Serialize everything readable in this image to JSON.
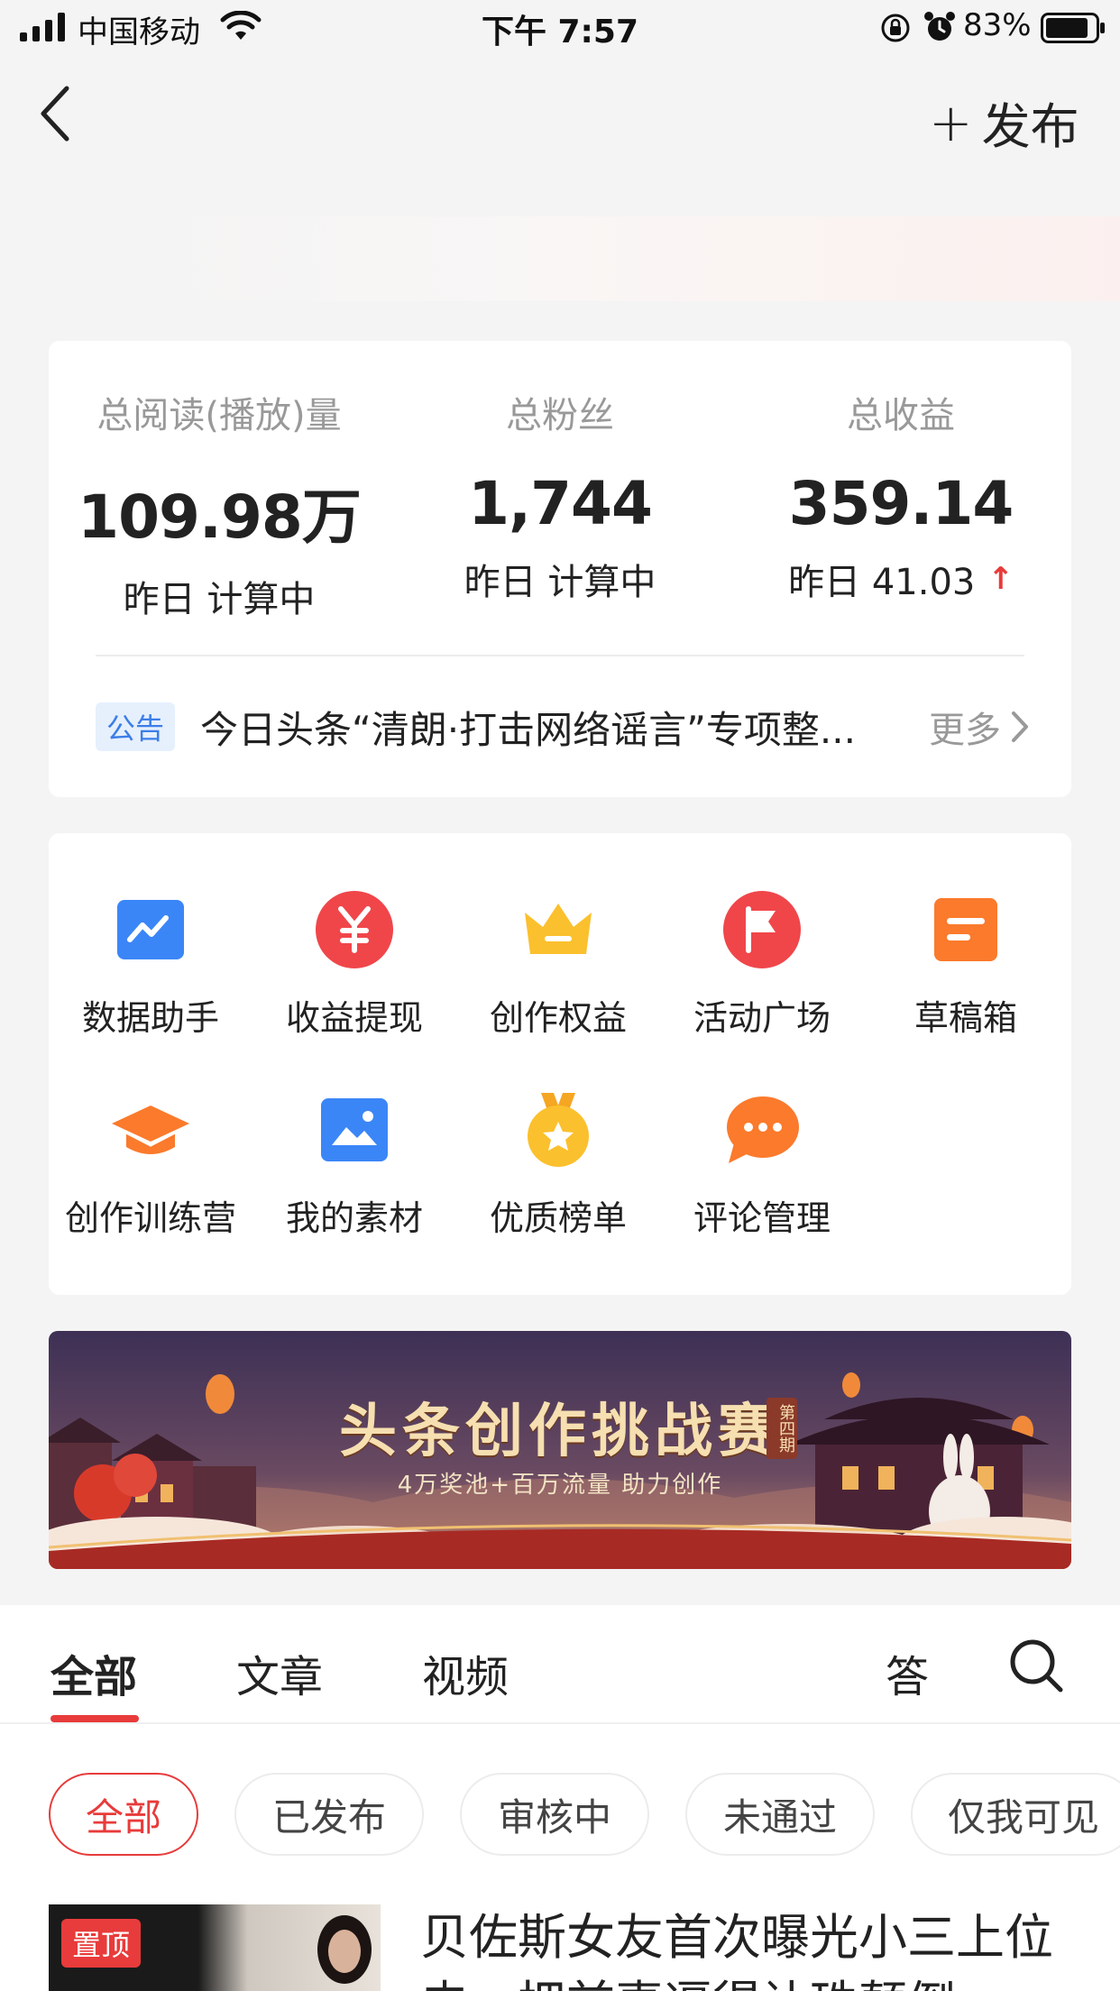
{
  "status_bar": {
    "carrier": "中国移动",
    "time": "下午 7:57",
    "battery": "83%"
  },
  "nav": {
    "publish_label": "发布"
  },
  "stats": [
    {
      "label": "总阅读(播放)量",
      "value": "109.98万",
      "sub": "昨日 计算中"
    },
    {
      "label": "总粉丝",
      "value": "1,744",
      "sub": "昨日 计算中"
    },
    {
      "label": "总收益",
      "value": "359.14",
      "sub": "昨日 41.03",
      "trend": "up"
    }
  ],
  "notice": {
    "badge": "公告",
    "text": "今日头条“清朗·打击网络谣言”专项整...",
    "more": "更多"
  },
  "tools": [
    {
      "label": "数据助手",
      "icon": "chart-icon"
    },
    {
      "label": "收益提现",
      "icon": "yuan-icon"
    },
    {
      "label": "创作权益",
      "icon": "crown-icon"
    },
    {
      "label": "活动广场",
      "icon": "flag-icon"
    },
    {
      "label": "草稿箱",
      "icon": "draft-icon"
    },
    {
      "label": "创作训练营",
      "icon": "graduation-cap-icon"
    },
    {
      "label": "我的素材",
      "icon": "image-icon"
    },
    {
      "label": "优质榜单",
      "icon": "medal-icon"
    },
    {
      "label": "评论管理",
      "icon": "comment-icon"
    }
  ],
  "promo": {
    "title": "头条创作挑战赛",
    "issue": "第四期",
    "subtitle": "4万奖池+百万流量  助力创作"
  },
  "tabs": [
    "全部",
    "文章",
    "视频",
    "答"
  ],
  "filters": [
    "全部",
    "已发布",
    "审核中",
    "未通过",
    "仅我可见"
  ],
  "article": {
    "pin": "置顶",
    "title": "贝佐斯女友首次曝光小三上位史，把前妻逼得让珠颠倒"
  },
  "colors": {
    "accent_red": "#e83b3b",
    "notice_blue": "#3c7ee8"
  }
}
